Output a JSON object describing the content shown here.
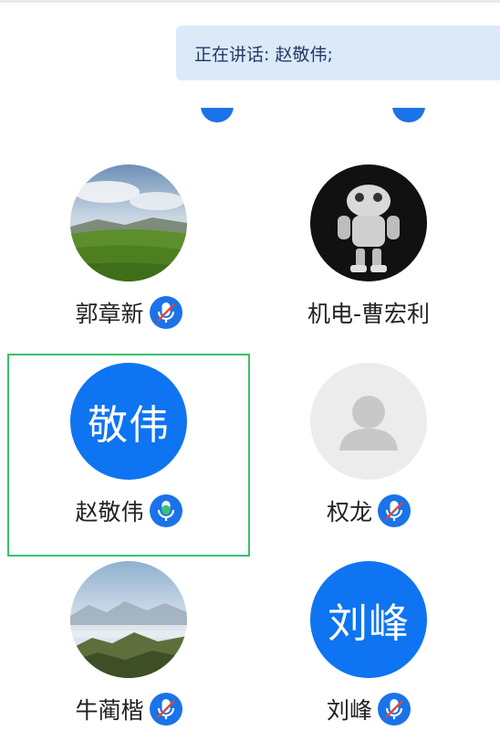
{
  "banner": {
    "text": "正在讲话: 赵敬伟;"
  },
  "participants": [
    {
      "name": "郭章新",
      "avatar_type": "photo-landscape",
      "mic": "muted"
    },
    {
      "name": "机电-曹宏利",
      "avatar_type": "photo-robot",
      "mic": "none"
    },
    {
      "name": "赵敬伟",
      "avatar_type": "text",
      "avatar_text": "敬伟",
      "mic": "speaking",
      "active": true
    },
    {
      "name": "权龙",
      "avatar_type": "placeholder",
      "mic": "muted"
    },
    {
      "name": "牛蔺楷",
      "avatar_type": "photo-mountains",
      "mic": "muted"
    },
    {
      "name": "刘峰",
      "avatar_type": "text",
      "avatar_text": "刘峰",
      "mic": "muted"
    }
  ],
  "colors": {
    "accent": "#1a73e8",
    "avatar_blue": "#0e74f1",
    "speaking_green": "#39c36d",
    "active_border": "#37c26b",
    "banner_bg": "#dbe9f9"
  },
  "icons": {
    "muted_mic": "mic-off-icon",
    "speaking_mic": "mic-speaking-icon"
  }
}
